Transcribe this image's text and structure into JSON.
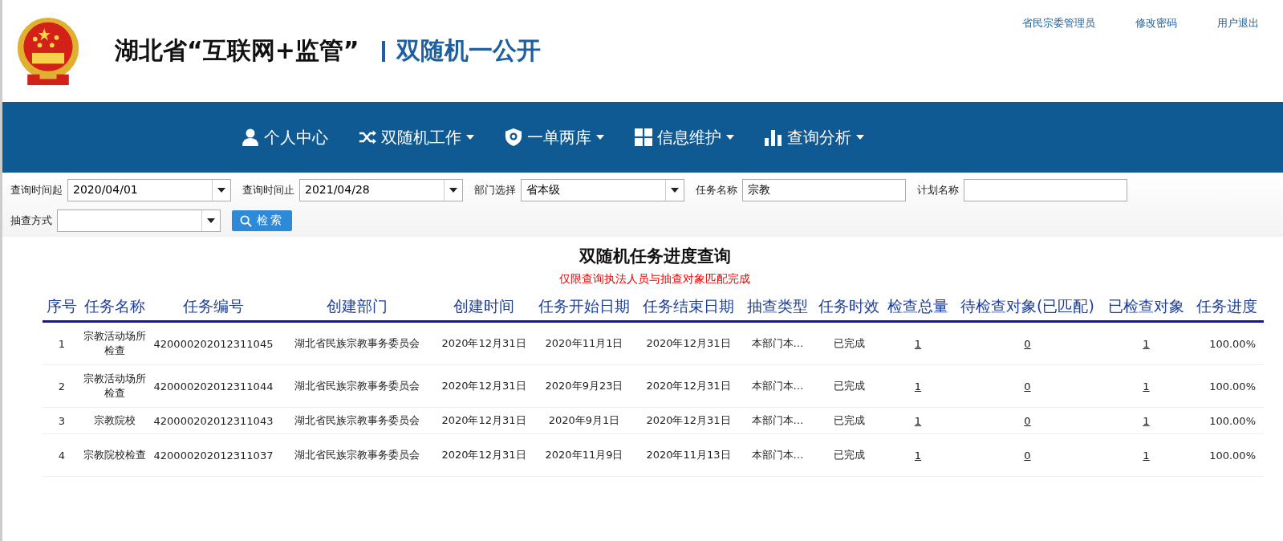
{
  "header": {
    "title": "湖北省“互联网+监管”",
    "subtitle": "双随机一公开",
    "user_links": [
      "省民宗委管理员",
      "修改密码",
      "用户退出"
    ]
  },
  "nav": [
    {
      "label": "个人中心",
      "dropdown": false
    },
    {
      "label": "双随机工作",
      "dropdown": true
    },
    {
      "label": "一单两库",
      "dropdown": true
    },
    {
      "label": "信息维护",
      "dropdown": true
    },
    {
      "label": "查询分析",
      "dropdown": true
    }
  ],
  "filters": [
    {
      "label": "查询时间起",
      "kind": "select",
      "value": "2020/04/01"
    },
    {
      "label": "查询时间止",
      "kind": "select",
      "value": "2021/04/28"
    },
    {
      "label": "部门选择",
      "kind": "select",
      "value": "省本级"
    },
    {
      "label": "任务名称",
      "kind": "input",
      "value": "宗教"
    },
    {
      "label": "计划名称",
      "kind": "input"
    },
    {
      "label": "抽查方式",
      "kind": "select"
    }
  ],
  "search_button": "检索",
  "report": {
    "title": "双随机任务进度查询",
    "note": "仅限查询执法人员与抽查对象匹配完成"
  },
  "table": {
    "columns": [
      {
        "label": "序号",
        "kind": "text"
      },
      {
        "label": "任务名称",
        "kind": "text"
      },
      {
        "label": "任务编号",
        "kind": "text"
      },
      {
        "label": "创建部门",
        "kind": "text"
      },
      {
        "label": "创建时间",
        "kind": "text"
      },
      {
        "label": "任务开始日期",
        "kind": "text"
      },
      {
        "label": "任务结束日期",
        "kind": "text"
      },
      {
        "label": "抽查类型",
        "kind": "text"
      },
      {
        "label": "任务时效",
        "kind": "text"
      },
      {
        "label": "检查总量",
        "kind": "link"
      },
      {
        "label": "待检查对象(已匹配)",
        "kind": "link"
      },
      {
        "label": "已检查对象",
        "kind": "link"
      },
      {
        "label": "任务进度",
        "kind": "right"
      }
    ],
    "rows": [
      [
        "1",
        "宗教活动场所检查",
        "420000202012311045",
        "湖北省民族宗教事务委员会",
        "2020年12月31日",
        "2020年11月1日",
        "2020年12月31日",
        "本部门本…",
        "已完成",
        "1",
        "0",
        "1",
        "100.00%"
      ],
      [
        "2",
        "宗教活动场所检查",
        "420000202012311044",
        "湖北省民族宗教事务委员会",
        "2020年12月31日",
        "2020年9月23日",
        "2020年12月31日",
        "本部门本…",
        "已完成",
        "1",
        "0",
        "1",
        "100.00%"
      ],
      [
        "3",
        "宗教院校",
        "420000202012311043",
        "湖北省民族宗教事务委员会",
        "2020年12月31日",
        "2020年9月1日",
        "2020年12月31日",
        "本部门本…",
        "已完成",
        "1",
        "0",
        "1",
        "100.00%"
      ],
      [
        "4",
        "宗教院校检查",
        "420000202012311037",
        "湖北省民族宗教事务委员会",
        "2020年12月31日",
        "2020年11月9日",
        "2020年11月13日",
        "本部门本…",
        "已完成",
        "1",
        "0",
        "1",
        "100.00%"
      ]
    ]
  }
}
